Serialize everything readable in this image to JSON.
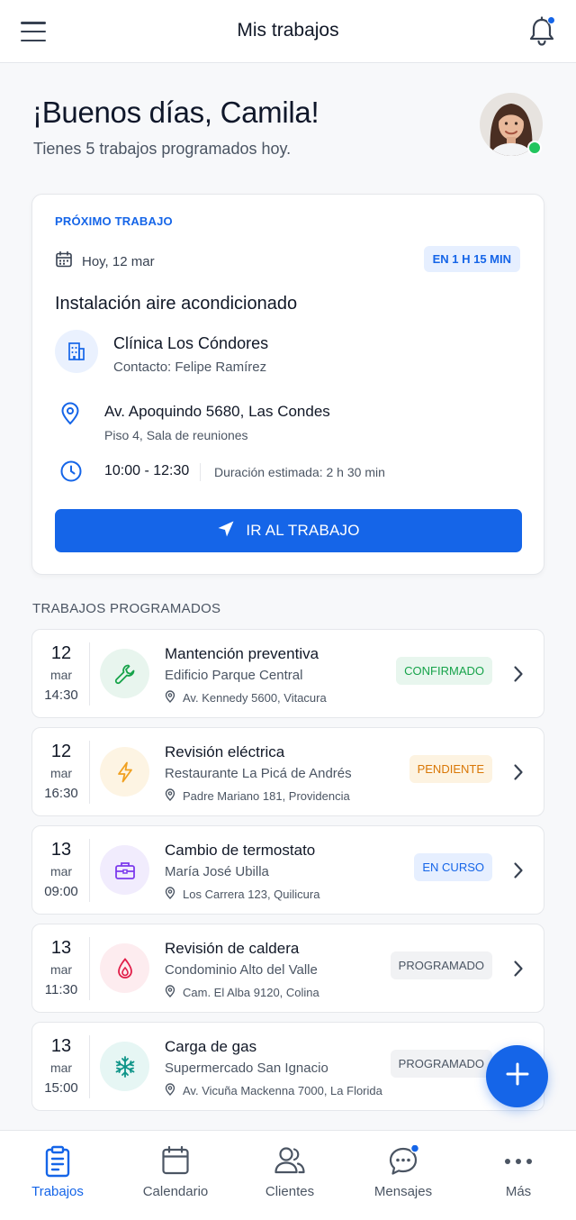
{
  "header": {
    "title": "Mis trabajos"
  },
  "greeting": {
    "title": "¡Buenos días, Camila!",
    "subtitle": "Tienes 5 trabajos programados hoy."
  },
  "next_job": {
    "label": "PRÓXIMO TRABAJO",
    "date": "Hoy, 12 mar",
    "eta": "EN 1 H 15 MIN",
    "title": "Instalación aire acondicionado",
    "client": "Clínica Los Cóndores",
    "contact": "Contacto: Felipe Ramírez",
    "address": "Av. Apoquindo 5680, Las Condes",
    "address_detail": "Piso 4, Sala de reuniones",
    "time": "10:00 - 12:30",
    "duration": "Duración estimada: 2 h 30 min",
    "button": "IR AL TRABAJO"
  },
  "section_label": "TRABAJOS PROGRAMADOS",
  "jobs": [
    {
      "day": "12",
      "month": "mar",
      "time": "14:30",
      "title": "Mantención preventiva",
      "client": "Edificio Parque Central",
      "address": "Av. Kennedy 5600, Vitacura",
      "status": "CONFIRMADO",
      "icon": "wrench-icon"
    },
    {
      "day": "12",
      "month": "mar",
      "time": "16:30",
      "title": "Revisión eléctrica",
      "client": "Restaurante La Picá de Andrés",
      "address": "Padre Mariano 181, Providencia",
      "status": "PENDIENTE",
      "icon": "bolt-icon"
    },
    {
      "day": "13",
      "month": "mar",
      "time": "09:00",
      "title": "Cambio de termostato",
      "client": "María José Ubilla",
      "address": "Los Carrera 123, Quilicura",
      "status": "EN CURSO",
      "icon": "toolbox-icon"
    },
    {
      "day": "13",
      "month": "mar",
      "time": "11:30",
      "title": "Revisión de caldera",
      "client": "Condominio Alto del Valle",
      "address": "Cam. El Alba 9120, Colina",
      "status": "PROGRAMADO",
      "icon": "flame-drop-icon"
    },
    {
      "day": "13",
      "month": "mar",
      "time": "15:00",
      "title": "Carga de gas",
      "client": "Supermercado San Ignacio",
      "address": "Av. Vicuña Mackenna 7000, La Florida",
      "status": "PROGRAMADO",
      "icon": "snowflake-icon"
    }
  ],
  "nav": [
    {
      "label": "Trabajos",
      "icon": "clipboard-icon",
      "active": true
    },
    {
      "label": "Calendario",
      "icon": "calendar-icon"
    },
    {
      "label": "Clientes",
      "icon": "users-icon"
    },
    {
      "label": "Mensajes",
      "icon": "chat-icon"
    },
    {
      "label": "Más",
      "icon": "more-icon"
    }
  ],
  "colors": {
    "accent": "#1565e8",
    "confirmed": "#16a34a",
    "pending": "#d97706",
    "in_progress": "#1565e8",
    "scheduled": "#4b5563",
    "online": "#22c55e"
  }
}
